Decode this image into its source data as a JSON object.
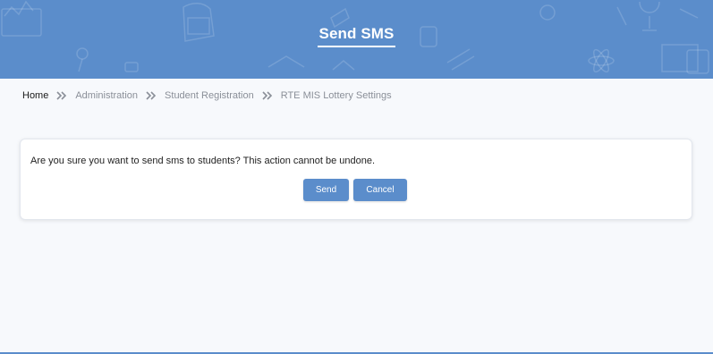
{
  "header": {
    "title": "Send SMS"
  },
  "breadcrumb": {
    "items": [
      "Home",
      "Administration",
      "Student Registration",
      "RTE MIS Lottery Settings"
    ],
    "separator_icon": "double-chevron-right-icon"
  },
  "dialog": {
    "message": "Are you sure you want to send sms to students? This action cannot be undone.",
    "send_label": "Send",
    "cancel_label": "Cancel"
  },
  "colors": {
    "accent": "#5b8dcb",
    "page_background": "#f7f9fc",
    "card_background": "#ffffff"
  }
}
